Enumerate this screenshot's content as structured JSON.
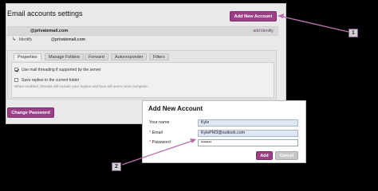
{
  "settings": {
    "title": "Email accounts settings",
    "add_account_label": "Add New Account",
    "account_email": "@privatemail.com",
    "add_identity_label": "add identity",
    "identity_label": "Identify",
    "identity_email": "@privatemail.com",
    "tabs": [
      {
        "label": "Properties",
        "active": true
      },
      {
        "label": "Manage Folders",
        "active": false
      },
      {
        "label": "Forward",
        "active": false
      },
      {
        "label": "Autoresponder",
        "active": false
      },
      {
        "label": "Filters",
        "active": false
      }
    ],
    "option_threading_label": "Use mail threading if supported by the server",
    "option_threading_checked": true,
    "option_replies_label": "Save replies to the current folder",
    "option_replies_checked": false,
    "hint": "When enabled, threads will include your replies and thus will seem more complete.",
    "change_password_label": "Change Password"
  },
  "dialog": {
    "title": "Add New Account",
    "name_label": "Your name",
    "email_label": "Email",
    "password_label": "Password",
    "name_value": "Kyle",
    "email_value": "KylePM3@outlook.com",
    "password_value": "•••••••",
    "add_label": "Add",
    "cancel_label": "Cancel"
  },
  "callouts": {
    "first": "1",
    "second": "2"
  },
  "colors": {
    "accent": "#9b3f86",
    "arrow": "#b86fae"
  }
}
